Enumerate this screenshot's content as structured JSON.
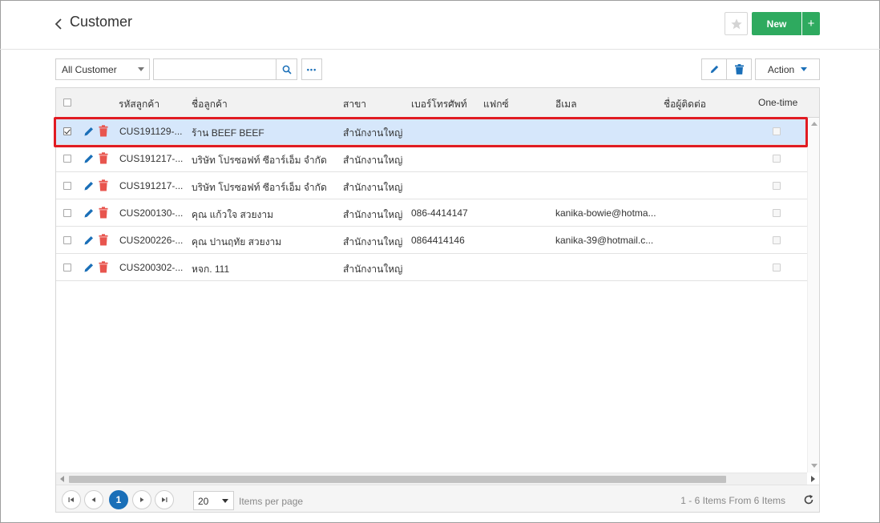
{
  "header": {
    "title": "Customer",
    "new_label": "New",
    "plus_label": "+"
  },
  "toolbar": {
    "filter_value": "All Customer",
    "search_value": "",
    "search_placeholder": "",
    "more_label": "•••",
    "action_label": "Action"
  },
  "grid": {
    "columns": [
      "รหัสลูกค้า",
      "ชื่อลูกค้า",
      "สาขา",
      "เบอร์โทรศัพท์",
      "แฟกซ์",
      "อีเมล",
      "ชื่อผู้ติดต่อ",
      "One-time"
    ],
    "rows": [
      {
        "code": "CUS191129-...",
        "name": "ร้าน BEEF BEEF",
        "branch": "สำนักงานใหญ่",
        "phone": "",
        "fax": "",
        "email": "",
        "contact": "",
        "selected": true
      },
      {
        "code": "CUS191217-...",
        "name": "บริษัท โปรซอฟท์ ซีอาร์เอ็ม จำกัด",
        "branch": "สำนักงานใหญ่",
        "phone": "",
        "fax": "",
        "email": "",
        "contact": "",
        "selected": false
      },
      {
        "code": "CUS191217-...",
        "name": "บริษัท โปรซอฟท์ ซีอาร์เอ็ม จำกัด",
        "branch": "สำนักงานใหญ่",
        "phone": "",
        "fax": "",
        "email": "",
        "contact": "",
        "selected": false
      },
      {
        "code": "CUS200130-...",
        "name": "คุณ แก้วใจ สวยงาม",
        "branch": "สำนักงานใหญ่",
        "phone": "086-4414147",
        "fax": "",
        "email": "kanika-bowie@hotma...",
        "contact": "",
        "selected": false
      },
      {
        "code": "CUS200226-...",
        "name": "คุณ ปานฤทัย สวยงาม",
        "branch": "สำนักงานใหญ่",
        "phone": "0864414146",
        "fax": "",
        "email": "kanika-39@hotmail.c...",
        "contact": "",
        "selected": false
      },
      {
        "code": "CUS200302-...",
        "name": "หจก. 111",
        "branch": "สำนักงานใหญ่",
        "phone": "",
        "fax": "",
        "email": "",
        "contact": "",
        "selected": false
      }
    ]
  },
  "pager": {
    "current_page": "1",
    "per_page": "20",
    "per_page_label": "Items per page",
    "info": "1 - 6 Items From 6 Items"
  },
  "colors": {
    "accent": "#1a6fb8",
    "new_button": "#2eaa5f",
    "selected_row": "#d6e7fb",
    "highlight_border": "#e11b22",
    "delete_icon": "#e8554e"
  },
  "icons": [
    "back-chevron-icon",
    "star-icon",
    "search-icon",
    "more-icon",
    "pencil-icon",
    "trash-icon",
    "caret-down-icon",
    "refresh-icon"
  ]
}
